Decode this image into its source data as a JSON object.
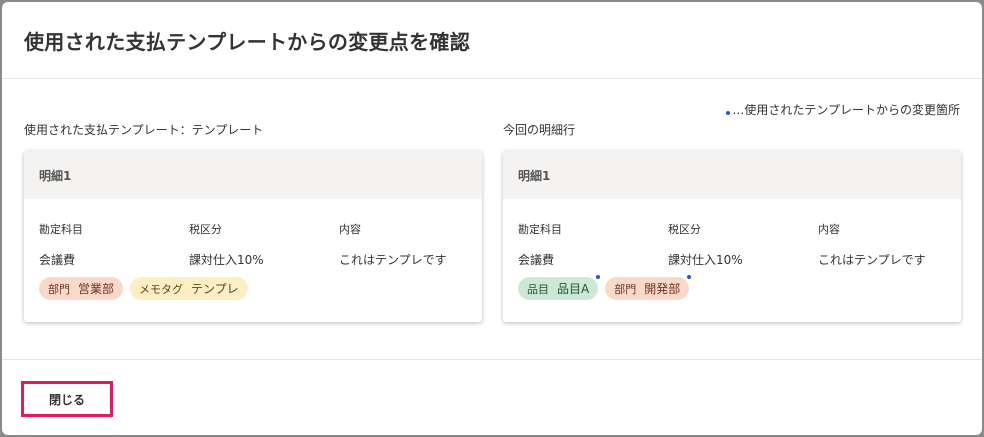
{
  "dialog": {
    "title": "使用された支払テンプレートからの変更点を確認",
    "legend_text": "…使用されたテンプレートからの変更箇所",
    "close_label": "閉じる"
  },
  "template_col": {
    "label": "使用された支払テンプレート：テンプレート",
    "card": {
      "title": "明細1",
      "fields": [
        {
          "label": "勘定科目",
          "value": "会議費"
        },
        {
          "label": "税区分",
          "value": "課対仕入10%"
        },
        {
          "label": "内容",
          "value": "これはテンプレです"
        }
      ],
      "tags": [
        {
          "key": "部門",
          "value": "営業部"
        },
        {
          "key": "メモタグ",
          "value": "テンプレ"
        }
      ]
    }
  },
  "current_col": {
    "label": "今回の明細行",
    "card": {
      "title": "明細1",
      "fields": [
        {
          "label": "勘定科目",
          "value": "会議費"
        },
        {
          "label": "税区分",
          "value": "課対仕入10%"
        },
        {
          "label": "内容",
          "value": "これはテンプレです"
        }
      ],
      "tags": [
        {
          "key": "品目",
          "value": "品目A"
        },
        {
          "key": "部門",
          "value": "開発部"
        }
      ]
    }
  },
  "colors": {
    "change_dot": "#2757d6",
    "close_highlight": "#e8185a",
    "tag_department": "#fbd9c9",
    "tag_memo": "#fdeec4",
    "tag_item": "#cde9d6"
  }
}
